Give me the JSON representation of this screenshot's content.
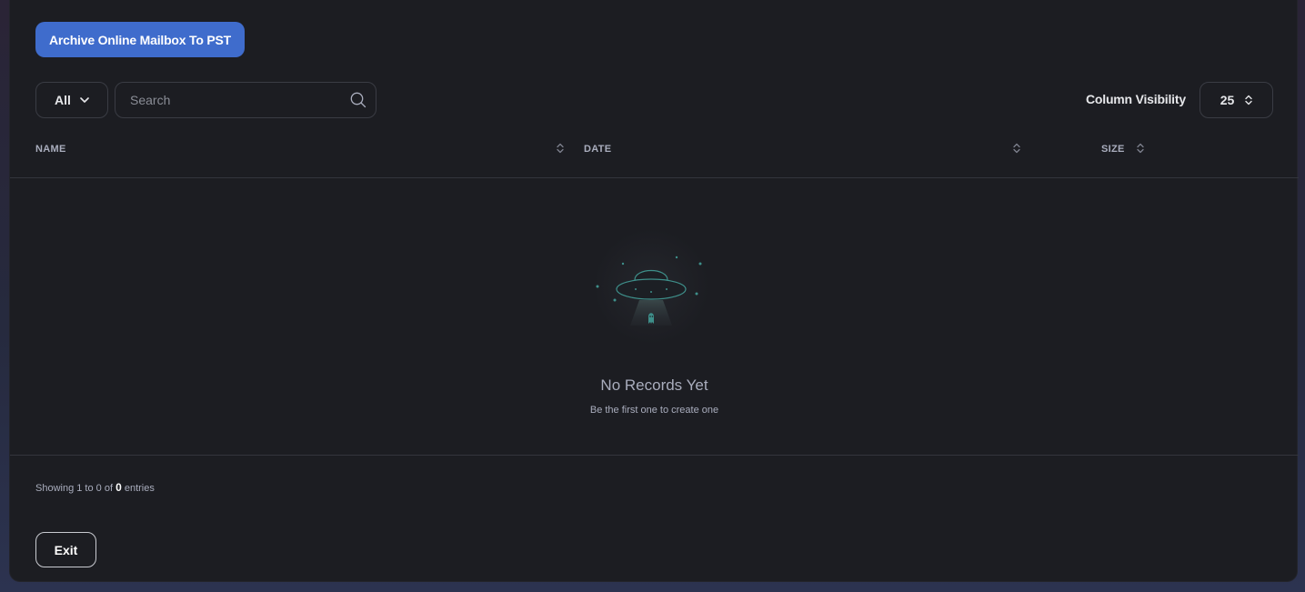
{
  "toolbar": {
    "archive_button_label": "Archive Online Mailbox To PST",
    "filter_value": "All",
    "search_placeholder": "Search",
    "column_visibility_label": "Column Visibility",
    "page_size_value": "25"
  },
  "table": {
    "columns": [
      "NAME",
      "DATE",
      "SIZE"
    ]
  },
  "empty_state": {
    "title": "No Records Yet",
    "subtitle": "Be the first one to create one"
  },
  "footer": {
    "showing_prefix": "Showing 1 to 0 of",
    "showing_total": "0",
    "showing_suffix": "entries",
    "exit_label": "Exit"
  },
  "colors": {
    "accent": "#3f6ccc",
    "panel_bg": "#1c1d22",
    "illustration_teal": "#3e8f8a"
  },
  "icons": [
    "chevron-down-icon",
    "search-icon",
    "sort-icon",
    "ufo-empty-icon"
  ]
}
